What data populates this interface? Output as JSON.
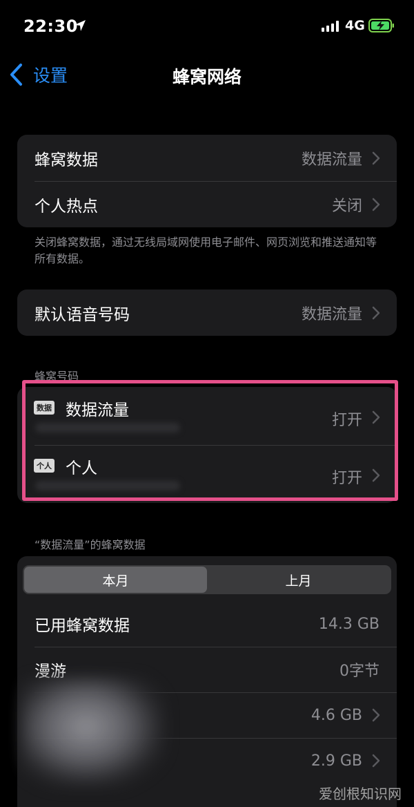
{
  "status_bar": {
    "time": "22:30",
    "network": "4G"
  },
  "nav": {
    "back_label": "设置",
    "title": "蜂窝网络"
  },
  "section1": {
    "rows": [
      {
        "label": "蜂窝数据",
        "value": "数据流量"
      },
      {
        "label": "个人热点",
        "value": "关闭"
      }
    ],
    "footer": "关闭蜂窝数据，通过无线局域网使用电子邮件、网页浏览和推送通知等所有数据。"
  },
  "section2": {
    "rows": [
      {
        "label": "默认语音号码",
        "value": "数据流量"
      }
    ]
  },
  "section3": {
    "header": "蜂窝号码",
    "lines": [
      {
        "badge": "数据",
        "name": "数据流量",
        "value": "打开"
      },
      {
        "badge": "个人",
        "name": "个人",
        "value": "打开"
      }
    ]
  },
  "section4": {
    "header": "“数据流量”的蜂窝数据",
    "segments": [
      "本月",
      "上月"
    ],
    "active_segment": "本月",
    "rows": [
      {
        "label": "已用蜂窝数据",
        "value": "14.3 GB"
      },
      {
        "label": "漫游",
        "value": "0字节"
      },
      {
        "label": "",
        "value": "4.6 GB"
      },
      {
        "label": "",
        "value": "2.9 GB"
      }
    ]
  },
  "watermark": "爱创根知识网",
  "colors": {
    "accent": "#2a8ef7",
    "highlight": "#e5508a",
    "background": "#000000",
    "cell": "#1c1c1e"
  }
}
